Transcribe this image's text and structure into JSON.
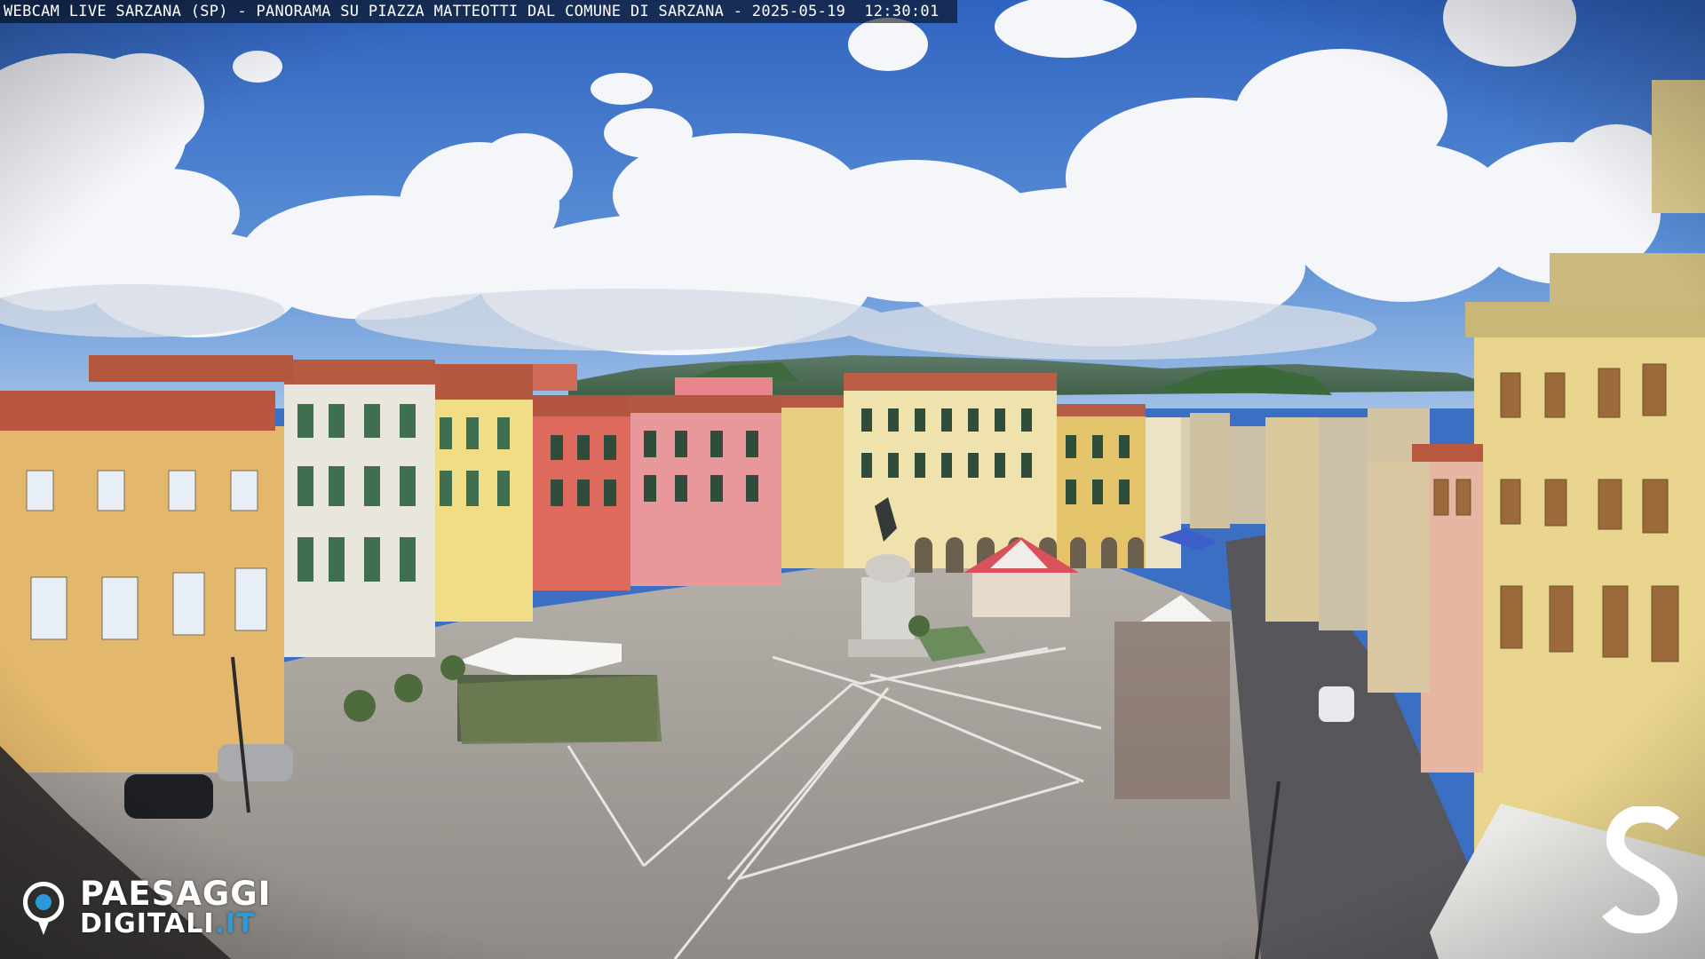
{
  "overlay": {
    "caption": "WEBCAM LIVE SARZANA (SP) - PANORAMA SU PIAZZA MATTEOTTI DAL COMUNE DI SARZANA - 2025-05-19  12:30:01"
  },
  "logos": {
    "provider_line1": "PAESAGGI",
    "provider_line2_main": "DIGITALI",
    "provider_line2_accent": ".IT",
    "provider_icon": "camera-pin-icon",
    "corner_mark": "S"
  },
  "colors": {
    "sky": "#3a6fc4",
    "cloud": "#f3f5f8",
    "pavement": "#9e9a95",
    "accent_blue": "#2c9ad8"
  }
}
